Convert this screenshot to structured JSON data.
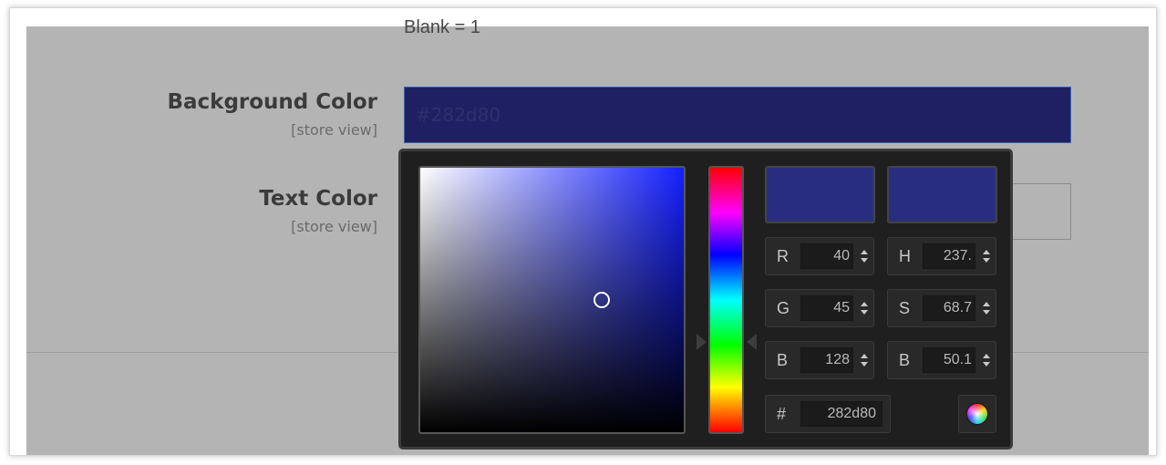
{
  "form": {
    "clipped_text": "Blank = 1",
    "background_color": {
      "label": "Background Color",
      "scope": "[store view]",
      "value": "#282d80"
    },
    "text_color": {
      "label": "Text Color",
      "scope": "[store view]",
      "value": ""
    }
  },
  "picker": {
    "current_color": "#282d80",
    "new_color": "#282d80",
    "hue_color": "#1420ff",
    "saturation_pct": 68.7,
    "brightness_pct": 50.1,
    "hue_pct": 65.8,
    "rgb": {
      "r_label": "R",
      "r": "40",
      "g_label": "G",
      "g": "45",
      "b_label": "B",
      "b": "128"
    },
    "hsb": {
      "h_label": "H",
      "h": "237.",
      "s_label": "S",
      "s": "68.7",
      "b_label": "B",
      "b": "50.1"
    },
    "hex_label": "#",
    "hex": "282d80",
    "wheel_icon": "color-wheel-icon"
  }
}
